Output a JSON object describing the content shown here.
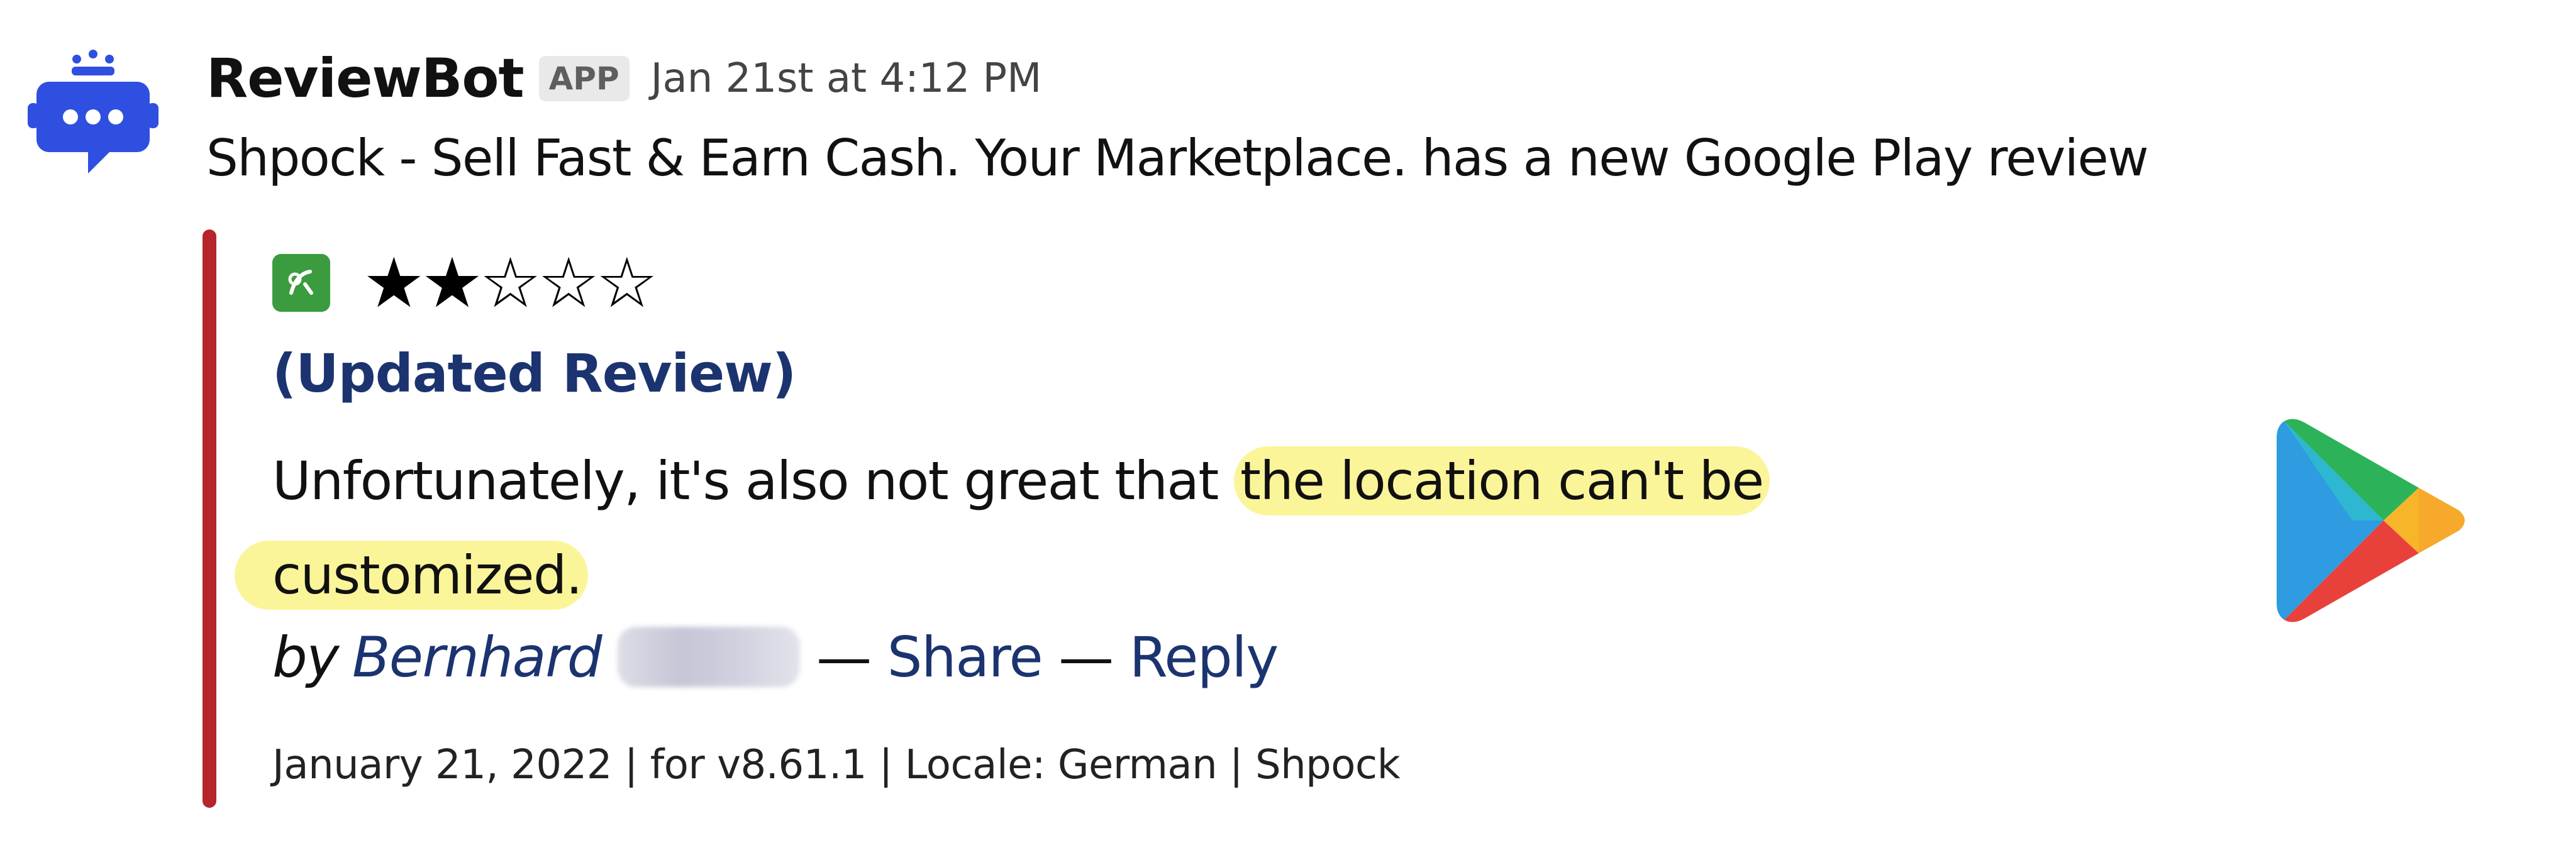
{
  "message": {
    "sender": "ReviewBot",
    "badge": "APP",
    "timestamp": "Jan 21st at 4:12 PM",
    "text": "Shpock - Sell Fast & Earn Cash. Your Marketplace. has a new Google Play review"
  },
  "review": {
    "rating": 2,
    "rating_max": 5,
    "stars_display": "★★☆☆☆",
    "title": "(Updated Review)",
    "body_plain": "Unfortunately, it's also not great that ",
    "body_highlight_1": "the location can't be",
    "body_highlight_2": "customized.",
    "by_word": "by",
    "author_first": "Bernhard",
    "dash_1": "—",
    "share_label": "Share",
    "dash_2": "—",
    "reply_label": "Reply",
    "meta": "January 21, 2022 | for v8.61.1 | Locale: German | Shpock"
  },
  "colors": {
    "accent_bar": "#b5252a",
    "link": "#1b3470",
    "highlight": "#fbf59a",
    "app_icon": "#3a9c3f",
    "avatar_blue": "#2f4fe0"
  },
  "icons": {
    "avatar": "robot-chat-icon",
    "app": "shpock-app-icon",
    "store": "google-play-icon"
  }
}
